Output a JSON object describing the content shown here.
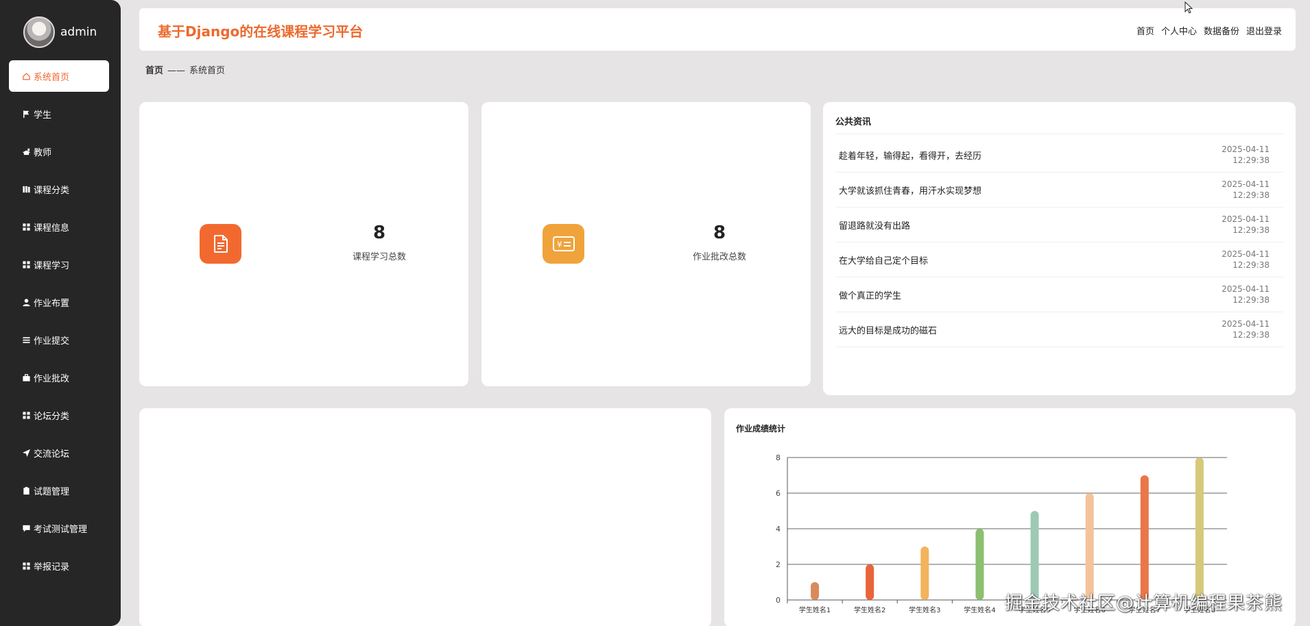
{
  "user": {
    "name": "admin"
  },
  "sidebar": {
    "items": [
      {
        "label": "系统首页",
        "icon": "home-icon",
        "active": true
      },
      {
        "label": "学生",
        "icon": "flag-icon"
      },
      {
        "label": "教师",
        "icon": "teacher-icon"
      },
      {
        "label": "课程分类",
        "icon": "book-icon"
      },
      {
        "label": "课程信息",
        "icon": "grid-icon"
      },
      {
        "label": "课程学习",
        "icon": "grid-icon"
      },
      {
        "label": "作业布置",
        "icon": "user-icon"
      },
      {
        "label": "作业提交",
        "icon": "list-icon"
      },
      {
        "label": "作业批改",
        "icon": "briefcase-icon"
      },
      {
        "label": "论坛分类",
        "icon": "grid-icon"
      },
      {
        "label": "交流论坛",
        "icon": "send-icon"
      },
      {
        "label": "试题管理",
        "icon": "clipboard-icon"
      },
      {
        "label": "考试测试管理",
        "icon": "comment-icon"
      },
      {
        "label": "举报记录",
        "icon": "grid-icon"
      }
    ]
  },
  "header": {
    "title": "基于Django的在线课程学习平台",
    "links": [
      "首页",
      "个人中心",
      "数据备份",
      "退出登录"
    ]
  },
  "breadcrumb": {
    "home": "首页",
    "sep": "——",
    "current": "系统首页"
  },
  "stats": [
    {
      "value": "8",
      "label": "课程学习总数",
      "icon": "document-icon",
      "color": "#f26930"
    },
    {
      "value": "8",
      "label": "作业批改总数",
      "icon": "yen-card-icon",
      "color": "#f0a33b"
    }
  ],
  "news": {
    "title": "公共资讯",
    "items": [
      {
        "text": "趁着年轻，输得起，看得开，去经历",
        "date": "2025-04-11",
        "time": "12:29:38"
      },
      {
        "text": "大学就该抓住青春，用汗水实现梦想",
        "date": "2025-04-11",
        "time": "12:29:38"
      },
      {
        "text": "留退路就没有出路",
        "date": "2025-04-11",
        "time": "12:29:38"
      },
      {
        "text": "在大学给自己定个目标",
        "date": "2025-04-11",
        "time": "12:29:38"
      },
      {
        "text": "做个真正的学生",
        "date": "2025-04-11",
        "time": "12:29:38"
      },
      {
        "text": "远大的目标是成功的磁石",
        "date": "2025-04-11",
        "time": "12:29:38"
      }
    ]
  },
  "chart_data": {
    "type": "bar",
    "title": "作业成绩统计",
    "categories": [
      "学生姓名1",
      "学生姓名2",
      "学生姓名3",
      "学生姓名4",
      "学生姓名5",
      "学生姓名6",
      "学生姓名7",
      "学生姓名8"
    ],
    "values": [
      1,
      2,
      3,
      4,
      5,
      6,
      7,
      8
    ],
    "colors": [
      "#d98a5b",
      "#e8653a",
      "#f2b35a",
      "#8cbf6f",
      "#9ec9b5",
      "#f2c49b",
      "#e97748",
      "#d6c97a"
    ],
    "ylim": [
      0,
      8
    ],
    "yticks": [
      0,
      2,
      4,
      6,
      8
    ],
    "grid": true
  },
  "watermark": "掘金技术社区@计算机编程果茶熊"
}
